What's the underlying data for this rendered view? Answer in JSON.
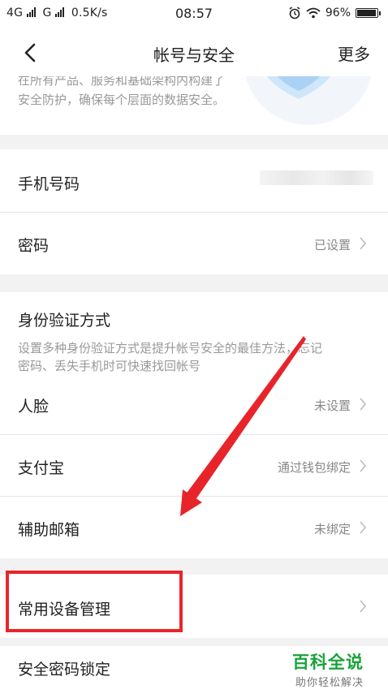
{
  "status_bar": {
    "network_left": "4G",
    "network_right": "G",
    "speed": "0.5K/s",
    "time": "08:57",
    "battery": "96%",
    "battery_level": 0.96
  },
  "nav": {
    "title": "帐号与安全",
    "more": "更多"
  },
  "intro": {
    "line1": "在所有产品、服务和基础架构内构建了",
    "line2": "安全防护，确保每个层面的数据安全。"
  },
  "rows": {
    "phone": {
      "label": "手机号码"
    },
    "password": {
      "label": "密码",
      "value": "已设置"
    }
  },
  "identity": {
    "heading": "身份验证方式",
    "desc_line1": "设置多种身份验证方式是提升帐号安全的最佳方法，忘记",
    "desc_line2": "密码、丢失手机时可快速找回帐号",
    "items": [
      {
        "label": "人脸",
        "value": "未设置"
      },
      {
        "label": "支付宝",
        "value": "通过钱包绑定"
      },
      {
        "label": "辅助邮箱",
        "value": "未绑定"
      }
    ]
  },
  "devices": {
    "label": "常用设备管理"
  },
  "lock": {
    "label": "安全密码锁定"
  },
  "watermark": {
    "title": "百科全说",
    "subtitle": "助你轻松解决"
  },
  "colors": {
    "highlight": "#e8242b",
    "watermark": "#1aa23a",
    "separator": "#f2f2f2"
  }
}
